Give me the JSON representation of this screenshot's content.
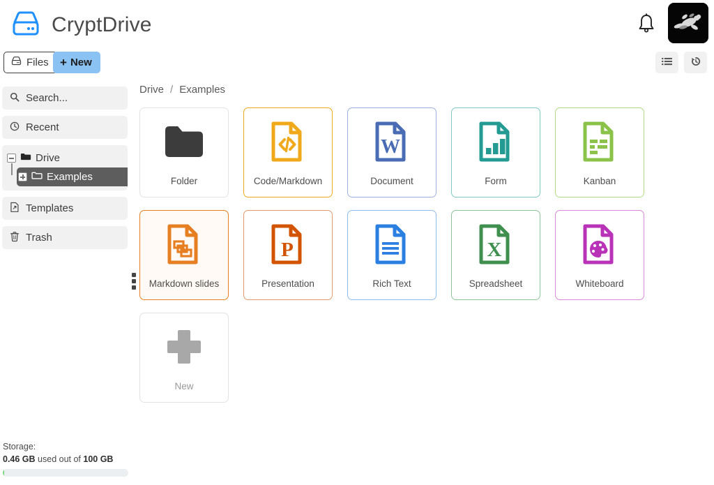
{
  "app": {
    "title": "CryptDrive",
    "brand_color": "#1e90ff"
  },
  "topbar": {
    "bell_label": "Notifications",
    "avatar_label": "User avatar"
  },
  "toolbar": {
    "files_label": "Files",
    "new_label": "New",
    "new_plus": "+",
    "view_list_label": "List view",
    "history_label": "History"
  },
  "sidebar": {
    "search_placeholder": "Search...",
    "search_label": "Search...",
    "recent_label": "Recent",
    "templates_label": "Templates",
    "trash_label": "Trash",
    "tree": [
      {
        "label": "Drive",
        "level": 1,
        "toggle": "collapse",
        "selected": false
      },
      {
        "label": "Examples",
        "level": 2,
        "toggle": "expand",
        "selected": true
      }
    ]
  },
  "storage": {
    "title": "Storage:",
    "used": "0.46 GB",
    "middle_text": " used out of ",
    "total": "100 GB",
    "percent": 0.46,
    "fill_color": "#7ed87e"
  },
  "breadcrumb": {
    "items": [
      "Drive",
      "Examples"
    ],
    "separator": "/"
  },
  "main": {
    "cards": [
      {
        "label": "Folder",
        "icon": "folder-icon",
        "color": "#3c3c3c",
        "border": "#e2e2e2",
        "tint": "#ffffff"
      },
      {
        "label": "Code/Markdown",
        "icon": "code-file-icon",
        "color": "#f0a91b",
        "border": "#f0a91b",
        "tint": "#ffffff"
      },
      {
        "label": "Document",
        "icon": "word-document-icon",
        "color": "#4a6cb5",
        "border": "#9db0dd",
        "tint": "#ffffff"
      },
      {
        "label": "Form",
        "icon": "form-chart-icon",
        "color": "#239b93",
        "border": "#7fc9c4",
        "tint": "#ffffff"
      },
      {
        "label": "Kanban",
        "icon": "kanban-icon",
        "color": "#8bc34a",
        "border": "#b2da86",
        "tint": "#ffffff"
      },
      {
        "label": "Markdown slides",
        "icon": "markdown-slides-icon",
        "color": "#e67e22",
        "border": "#e67e22",
        "tint": "#fffaf6"
      },
      {
        "label": "Presentation",
        "icon": "presentation-icon",
        "color": "#d35400",
        "border": "#e09a6e",
        "tint": "#ffffff"
      },
      {
        "label": "Rich Text",
        "icon": "rich-text-icon",
        "color": "#2a7fe0",
        "border": "#8ebcec",
        "tint": "#ffffff"
      },
      {
        "label": "Spreadsheet",
        "icon": "spreadsheet-icon",
        "color": "#3f8f4f",
        "border": "#8fc39a",
        "tint": "#ffffff"
      },
      {
        "label": "Whiteboard",
        "icon": "whiteboard-icon",
        "color": "#b833b8",
        "border": "#d98ad9",
        "tint": "#ffffff"
      },
      {
        "label": "New",
        "icon": "plus-icon",
        "color": "#a8a8a8",
        "border": "#e2e2e2",
        "tint": "#ffffff"
      }
    ]
  }
}
